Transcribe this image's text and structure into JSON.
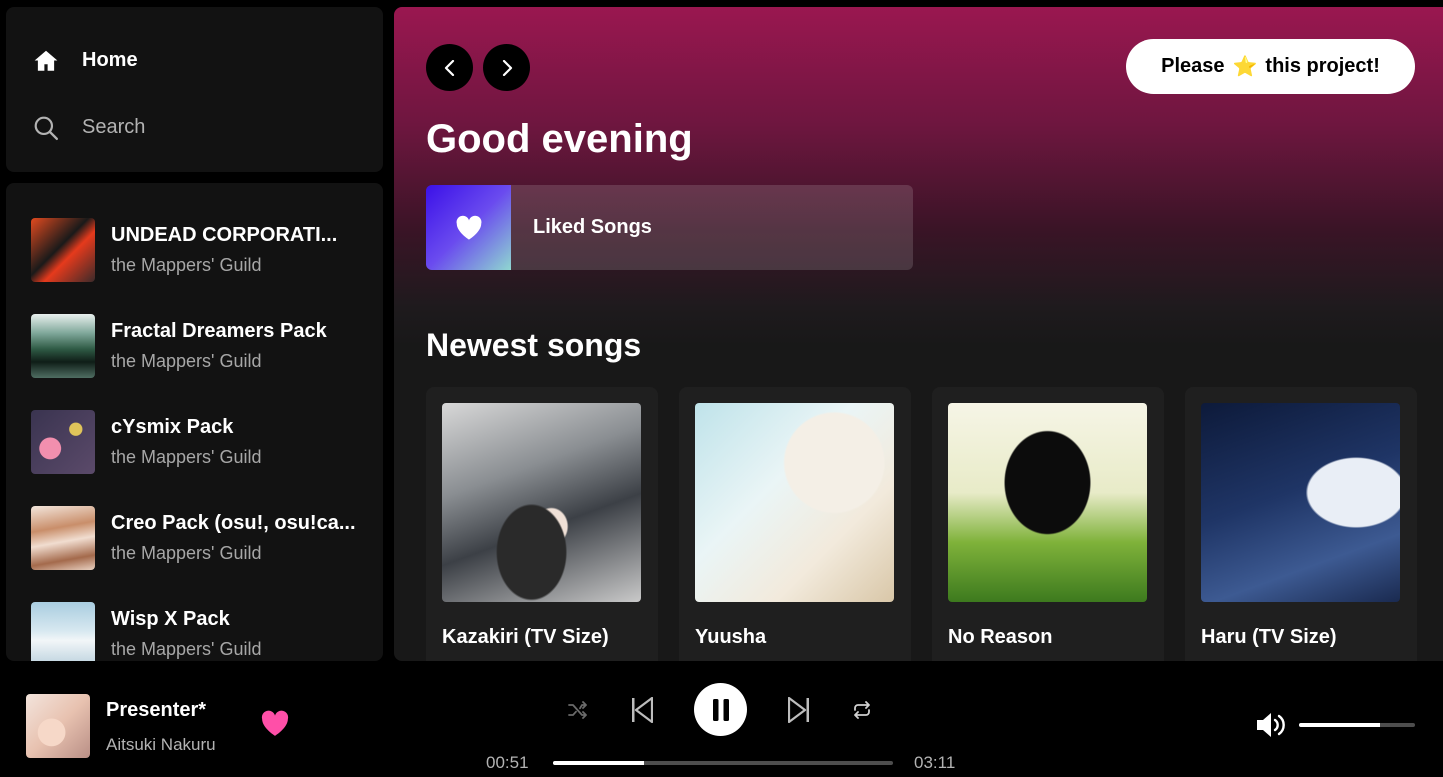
{
  "nav": {
    "home_label": "Home",
    "search_label": "Search"
  },
  "library": [
    {
      "title": "UNDEAD CORPORATI...",
      "subtitle": "the Mappers' Guild"
    },
    {
      "title": "Fractal Dreamers Pack",
      "subtitle": "the Mappers' Guild"
    },
    {
      "title": "cYsmix Pack",
      "subtitle": "the Mappers' Guild"
    },
    {
      "title": "Creo Pack (osu!, osu!ca...",
      "subtitle": "the Mappers' Guild"
    },
    {
      "title": "Wisp X Pack",
      "subtitle": "the Mappers' Guild"
    }
  ],
  "header": {
    "star_prefix": "Please",
    "star_emoji": "⭐",
    "star_suffix": "this project!"
  },
  "greeting": "Good evening",
  "liked_songs_label": "Liked Songs",
  "newest": {
    "title": "Newest songs",
    "songs": [
      {
        "title": "Kazakiri (TV Size)"
      },
      {
        "title": "Yuusha"
      },
      {
        "title": "No Reason"
      },
      {
        "title": "Haru (TV Size)"
      }
    ]
  },
  "player": {
    "title": "Presenter*",
    "artist": "Aitsuki Nakuru",
    "elapsed": "00:51",
    "duration": "03:11",
    "progress_fraction": 0.267,
    "volume_fraction": 0.7
  },
  "colors": {
    "accent_heart": "#ff4fa8",
    "gradient_top": "#9a1750"
  }
}
